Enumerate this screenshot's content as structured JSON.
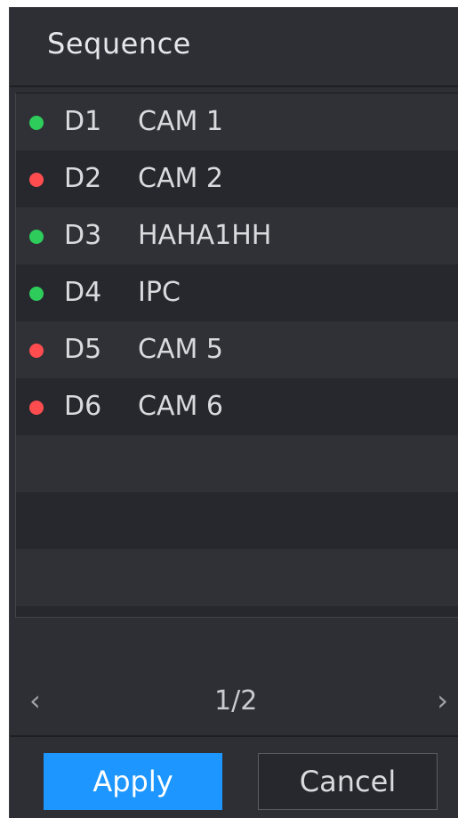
{
  "title": "Sequence",
  "colors": {
    "online": "#2ecc5b",
    "offline": "#ff4d4f",
    "accent": "#1e96ff"
  },
  "channels": [
    {
      "id": "D1",
      "name": "CAM 1",
      "status": "online"
    },
    {
      "id": "D2",
      "name": "CAM 2",
      "status": "offline"
    },
    {
      "id": "D3",
      "name": "HAHA1HH",
      "status": "online"
    },
    {
      "id": "D4",
      "name": "IPC",
      "status": "online"
    },
    {
      "id": "D5",
      "name": "CAM 5",
      "status": "offline"
    },
    {
      "id": "D6",
      "name": "CAM 6",
      "status": "offline"
    }
  ],
  "pager": {
    "label": "1/2",
    "prev_icon": "chevron-left-icon",
    "next_icon": "chevron-right-icon"
  },
  "buttons": {
    "apply": "Apply",
    "cancel": "Cancel"
  }
}
